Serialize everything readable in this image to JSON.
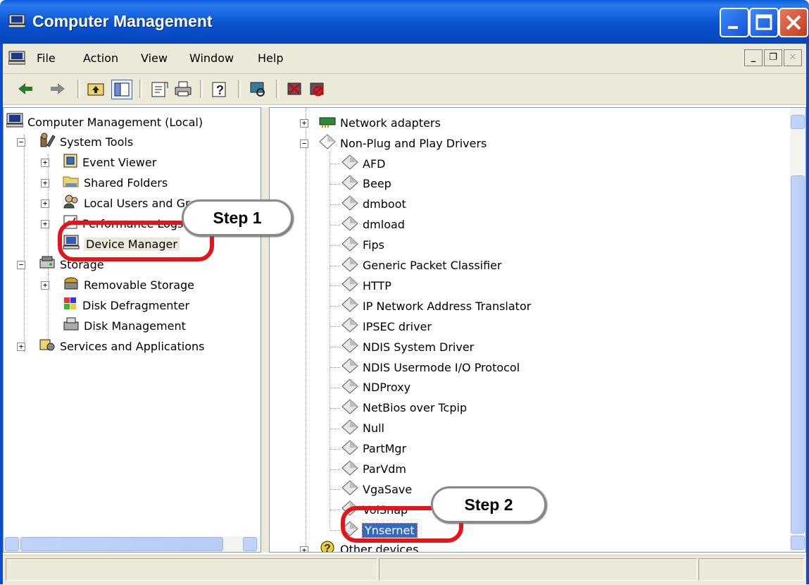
{
  "window": {
    "title": "Computer Management"
  },
  "menu": {
    "items": [
      "File",
      "Action",
      "View",
      "Window",
      "Help"
    ]
  },
  "left_tree": [
    {
      "label": "Computer Management (Local)",
      "icon": "computer-icon"
    },
    {
      "label": "System Tools",
      "icon": "tools-icon"
    },
    {
      "label": "Event Viewer",
      "icon": "event-viewer-icon"
    },
    {
      "label": "Shared Folders",
      "icon": "folder-icon"
    },
    {
      "label": "Local Users and Groups",
      "icon": "users-icon"
    },
    {
      "label": "Performance Logs and Alerts",
      "icon": "performance-icon"
    },
    {
      "label": "Device Manager",
      "icon": "device-manager-icon"
    },
    {
      "label": "Storage",
      "icon": "storage-icon"
    },
    {
      "label": "Removable Storage",
      "icon": "removable-storage-icon"
    },
    {
      "label": "Disk Defragmenter",
      "icon": "defrag-icon"
    },
    {
      "label": "Disk Management",
      "icon": "disk-management-icon"
    },
    {
      "label": "Services and Applications",
      "icon": "services-icon"
    }
  ],
  "right_tree": {
    "top": {
      "label": "Network adapters",
      "icon": "network-adapter-icon"
    },
    "group": {
      "label": "Non-Plug and Play Drivers",
      "icon": "driver-diamond-icon"
    },
    "drivers": [
      "AFD",
      "Beep",
      "dmboot",
      "dmload",
      "Fips",
      "Generic Packet Classifier",
      "HTTP",
      "IP Network Address Translator",
      "IPSEC driver",
      "NDIS System Driver",
      "NDIS Usermode I/O Protocol",
      "NDProxy",
      "NetBios over Tcpip",
      "Null",
      "PartMgr",
      "ParVdm",
      "VgaSave",
      "VolSnap",
      "Ynsernet"
    ],
    "bottom": {
      "label": "Other devices",
      "icon": "unknown-device-icon"
    }
  },
  "annotations": {
    "step1": "Step 1",
    "step2": "Step 2"
  },
  "colors": {
    "titlebar": "#0b56d4",
    "selection": "#316ac5",
    "annotation_ring": "#e4141b"
  }
}
